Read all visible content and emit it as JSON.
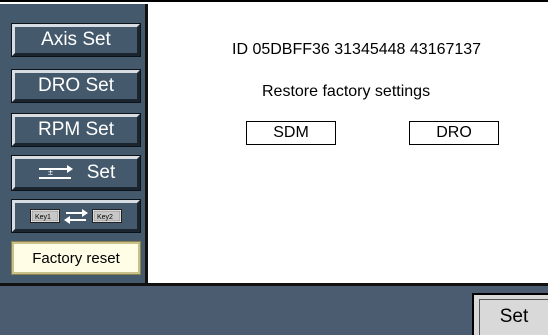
{
  "sidebar": {
    "axis_set": "Axis Set",
    "dro_set": "DRO Set",
    "rpm_set": "RPM Set",
    "dir_set": "Set",
    "key_left": "Key1",
    "key_right": "Key2",
    "factory_reset": "Factory reset"
  },
  "main": {
    "id_text": "ID 05DBFF36 31345448 43167137",
    "restore_text": "Restore factory settings",
    "options": [
      "SDM",
      "DRO"
    ]
  },
  "bottom": {
    "set_label": "Set"
  },
  "icons": {
    "dir_icon": "plus-minus-arrows-icon",
    "swap_icon": "swap-arrows-icon"
  },
  "colors": {
    "sidebar_bg": "#44596b",
    "active_bg": "#fffde6",
    "bottom_bg": "#4b5c70"
  }
}
